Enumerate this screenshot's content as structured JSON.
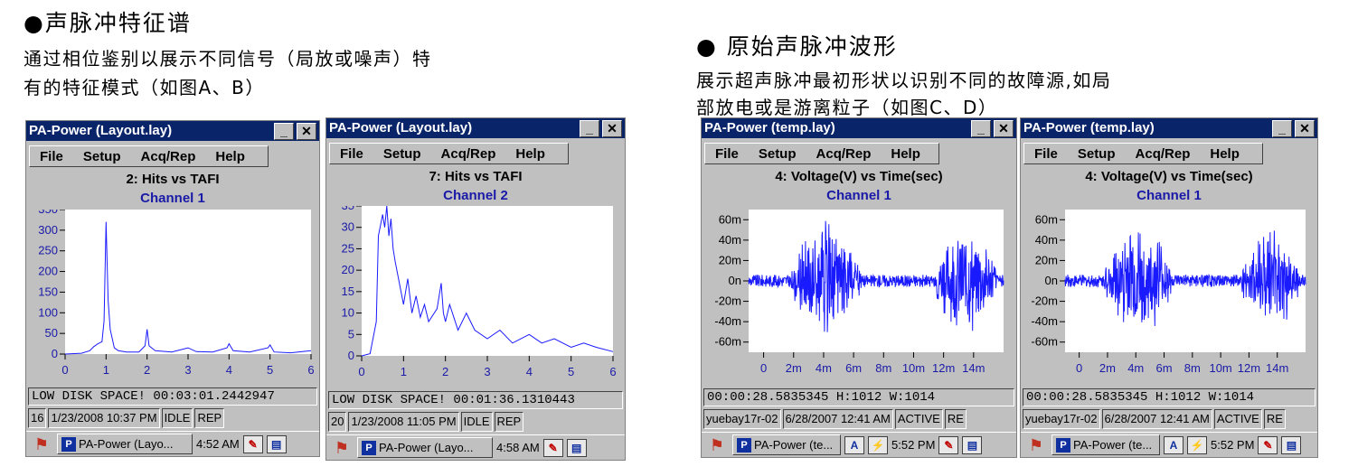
{
  "left_heading": {
    "title": "●声脉冲特征谱",
    "desc_line1": "通过相位鉴别以展示不同信号（局放或噪声）特",
    "desc_line2": "有的特征模式（如图A、B）"
  },
  "right_heading": {
    "title": "● 原始声脉冲波形",
    "desc_line1": "展示超声脉冲最初形状以识别不同的故障源,如局",
    "desc_line2": "部放电或是游离粒子（如图C、D）"
  },
  "panels": [
    {
      "window_title": "PA-Power (Layout.lay)",
      "menu": [
        "File",
        "Setup",
        "Acq/Rep",
        "Help"
      ],
      "chart_title": "2: Hits vs TAFI",
      "chart_subtitle": "Channel 1",
      "status_line": "LOW DISK SPACE! 00:03:01.2442947",
      "statusbar": [
        "16",
        "1/23/2008 10:37 PM",
        "IDLE",
        "REP"
      ],
      "task_label": "PA-Power (Layo...",
      "clock": "4:52 AM"
    },
    {
      "window_title": "PA-Power (Layout.lay)",
      "menu": [
        "File",
        "Setup",
        "Acq/Rep",
        "Help"
      ],
      "chart_title": "7: Hits vs TAFI",
      "chart_subtitle": "Channel 2",
      "status_line": "LOW DISK SPACE! 00:01:36.1310443",
      "statusbar": [
        "20",
        "1/23/2008 11:05 PM",
        "IDLE",
        "REP"
      ],
      "task_label": "PA-Power (Layo...",
      "clock": "4:58 AM"
    },
    {
      "window_title": "PA-Power (temp.lay)",
      "menu": [
        "File",
        "Setup",
        "Acq/Rep",
        "Help"
      ],
      "chart_title": "4: Voltage(V) vs Time(sec)",
      "chart_subtitle": "Channel 1",
      "status_line": "00:00:28.5835345 H:1012 W:1014",
      "statusbar": [
        "yuebay17r-02",
        "6/28/2007 12:41 AM",
        "ACTIVE",
        "RE"
      ],
      "task_label": "PA-Power (te...",
      "clock": "5:52 PM"
    },
    {
      "window_title": "PA-Power (temp.lay)",
      "menu": [
        "File",
        "Setup",
        "Acq/Rep",
        "Help"
      ],
      "chart_title": "4: Voltage(V) vs Time(sec)",
      "chart_subtitle": "Channel 1",
      "status_line": "00:00:28.5835345 H:1012 W:1014",
      "statusbar": [
        "yuebay17r-02",
        "6/28/2007 12:41 AM",
        "ACTIVE",
        "RE"
      ],
      "task_label": "PA-Power (te...",
      "clock": "5:52 PM"
    }
  ],
  "colors": {
    "titlebar": "#0a246a",
    "chrome": "#c0c0c0",
    "trace": "#1a1aff",
    "axis_labels": "#1a1aa8"
  },
  "chart_data": [
    {
      "type": "line",
      "title": "2: Hits vs TAFI",
      "subtitle": "Channel 1",
      "xlim": [
        0,
        6
      ],
      "ylim": [
        0,
        350
      ],
      "x_ticks": [
        0,
        1,
        2,
        3,
        4,
        5,
        6
      ],
      "y_ticks": [
        0,
        50,
        100,
        150,
        200,
        250,
        300,
        350
      ],
      "x": [
        0,
        0.4,
        0.6,
        0.7,
        0.8,
        0.9,
        0.95,
        1.0,
        1.05,
        1.1,
        1.2,
        1.3,
        1.5,
        1.8,
        1.95,
        2.0,
        2.05,
        2.2,
        2.6,
        3.0,
        3.2,
        3.6,
        3.95,
        4.0,
        4.1,
        4.5,
        4.95,
        5.0,
        5.1,
        5.5,
        6.0
      ],
      "values": [
        0,
        2,
        8,
        18,
        25,
        30,
        80,
        320,
        130,
        60,
        15,
        8,
        5,
        5,
        20,
        60,
        20,
        8,
        5,
        15,
        6,
        5,
        15,
        25,
        8,
        5,
        15,
        22,
        5,
        3,
        8
      ]
    },
    {
      "type": "line",
      "title": "7: Hits vs TAFI",
      "subtitle": "Channel 2",
      "xlim": [
        0,
        6
      ],
      "ylim": [
        0,
        35
      ],
      "x_ticks": [
        0,
        1,
        2,
        3,
        4,
        5,
        6
      ],
      "y_ticks": [
        0,
        5,
        10,
        15,
        20,
        25,
        30,
        35
      ],
      "x": [
        0,
        0.2,
        0.35,
        0.4,
        0.5,
        0.55,
        0.6,
        0.65,
        0.7,
        0.75,
        0.8,
        0.9,
        1.0,
        1.1,
        1.2,
        1.3,
        1.4,
        1.5,
        1.6,
        1.8,
        1.9,
        1.95,
        2.0,
        2.1,
        2.3,
        2.5,
        2.7,
        3.0,
        3.3,
        3.6,
        4.0,
        4.3,
        4.6,
        5.0,
        5.3,
        5.6,
        6.0
      ],
      "values": [
        0,
        0.5,
        8,
        28,
        33,
        30,
        35,
        28,
        32,
        25,
        22,
        17,
        12,
        18,
        10,
        14,
        9,
        12,
        8,
        11,
        17,
        10,
        8,
        12,
        6,
        10,
        6,
        4,
        6,
        3,
        5,
        3,
        4,
        2,
        3,
        2,
        1
      ]
    },
    {
      "type": "line",
      "title": "4: Voltage(V) vs Time(sec)",
      "subtitle": "Channel 1",
      "xlim": [
        -0.001,
        0.016
      ],
      "ylim": [
        -0.07,
        0.07
      ],
      "x_tick_labels": [
        "0",
        "2m",
        "4m",
        "6m",
        "8m",
        "10m",
        "12m",
        "14m"
      ],
      "y_tick_labels": [
        "60m",
        "40m",
        "20m",
        "0n",
        "-20m",
        "-40m",
        "-60m"
      ],
      "bursts": [
        {
          "start": 0.0018,
          "end": 0.0065,
          "amplitude": 0.06
        },
        {
          "start": 0.0115,
          "end": 0.0155,
          "amplitude": 0.06
        }
      ],
      "baseline_noise": 0.006
    },
    {
      "type": "line",
      "title": "4: Voltage(V) vs Time(sec)",
      "subtitle": "Channel 1",
      "xlim": [
        -0.001,
        0.016
      ],
      "ylim": [
        -0.07,
        0.07
      ],
      "x_tick_labels": [
        "0",
        "2m",
        "4m",
        "6m",
        "8m",
        "10m",
        "12m",
        "14m"
      ],
      "y_tick_labels": [
        "60m",
        "40m",
        "20m",
        "0n",
        "-20m",
        "-40m",
        "-60m"
      ],
      "bursts": [
        {
          "start": 0.0018,
          "end": 0.0065,
          "amplitude": 0.06
        },
        {
          "start": 0.0115,
          "end": 0.0155,
          "amplitude": 0.06
        }
      ],
      "baseline_noise": 0.006
    }
  ]
}
